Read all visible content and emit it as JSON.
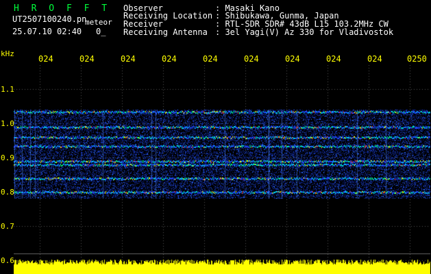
{
  "header": {
    "app_title": "H R O F F T",
    "filename": "UT2507100240.pn",
    "mode": "meteor",
    "datetime": "25.07.10 02:40",
    "extra": "0_"
  },
  "info": [
    {
      "label": "Observer",
      "value": ": Masaki Kano"
    },
    {
      "label": "Receiving Location",
      "value": ": Shibukawa, Gunma, Japan"
    },
    {
      "label": "Receiver",
      "value": ": RTL-SDR SDR# 43dB L15 103.2MHz CW"
    },
    {
      "label": "Receiving Antenna",
      "value": ": 3el Yagi(V) Az 330 for Vladivostok"
    }
  ],
  "axis": {
    "unit": "kHz",
    "time_ticks": [
      "024",
      "024",
      "024",
      "024",
      "024",
      "024",
      "024",
      "024",
      "024",
      "0250"
    ],
    "freq_ticks": [
      "1.1",
      "1.0",
      "0.9",
      "0.8",
      "0.7",
      "0.6"
    ]
  },
  "colors": {
    "accent_title": "#00ff3c",
    "axis_label": "#ffff00",
    "power_bar": "#ffff00",
    "background": "#000000"
  }
}
